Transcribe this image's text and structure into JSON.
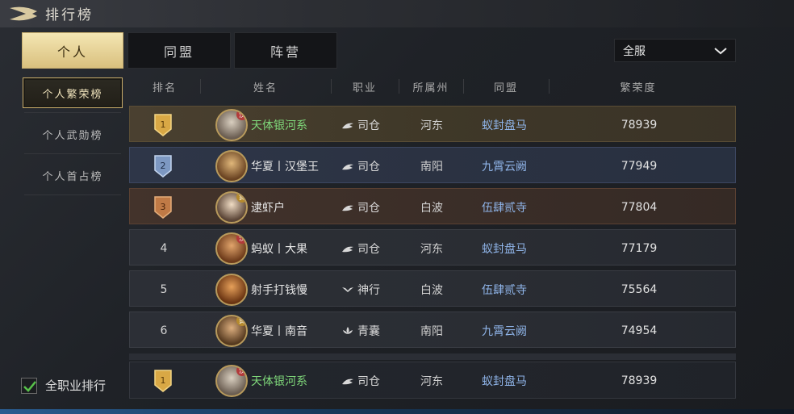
{
  "header": {
    "title": "排行榜"
  },
  "tabs": [
    {
      "label": "个人",
      "active": true
    },
    {
      "label": "同盟",
      "active": false
    },
    {
      "label": "阵营",
      "active": false
    }
  ],
  "server_select": {
    "value": "全服"
  },
  "sidebar": {
    "items": [
      {
        "label": "个人繁荣榜",
        "active": true
      },
      {
        "label": "个人武勋榜",
        "active": false
      },
      {
        "label": "个人首占榜",
        "active": false
      }
    ]
  },
  "columns": {
    "rank": "排名",
    "name": "姓名",
    "job": "职业",
    "region": "所属州",
    "alliance": "同盟",
    "score": "繁荣度"
  },
  "rows": [
    {
      "rank": "1",
      "name": "天体银河系",
      "job": "司仓",
      "region": "河东",
      "alliance": "蚁封盘马",
      "score": "78939",
      "tier": "gold",
      "name_color": "green",
      "avatar_tag": "汉"
    },
    {
      "rank": "2",
      "name": "华夏丨汉堡王",
      "job": "司仓",
      "region": "南阳",
      "alliance": "九霄云阙",
      "score": "77949",
      "tier": "silver",
      "name_color": "white",
      "avatar_tag": ""
    },
    {
      "rank": "3",
      "name": "逮虾户",
      "job": "司仓",
      "region": "白波",
      "alliance": "伍肆贰寺",
      "score": "77804",
      "tier": "bronze",
      "name_color": "white",
      "avatar_tag": "黄"
    },
    {
      "rank": "4",
      "name": "蚂蚁丨大果",
      "job": "司仓",
      "region": "河东",
      "alliance": "蚁封盘马",
      "score": "77179",
      "tier": "normal",
      "name_color": "white",
      "avatar_tag": "汉"
    },
    {
      "rank": "5",
      "name": "射手打钱慢",
      "job": "神行",
      "region": "白波",
      "alliance": "伍肆贰寺",
      "score": "75564",
      "tier": "normal",
      "name_color": "white",
      "avatar_tag": ""
    },
    {
      "rank": "6",
      "name": "华夏丨南音",
      "job": "青囊",
      "region": "南阳",
      "alliance": "九霄云阙",
      "score": "74954",
      "tier": "normal",
      "name_color": "white",
      "avatar_tag": "黄"
    }
  ],
  "self_row": {
    "rank": "1",
    "name": "天体银河系",
    "job": "司仓",
    "region": "河东",
    "alliance": "蚁封盘马",
    "score": "78939",
    "avatar_tag": "汉"
  },
  "footer": {
    "all_job_label": "全职业排行",
    "all_job_checked": true
  },
  "colors": {
    "gold_tab": "#e8d49a",
    "name_green": "#7fd87a",
    "alliance_blue": "#8fb4e8",
    "gold_border": "#c9ad6a"
  },
  "icons": {
    "back": "back-arrow-icon",
    "dropdown": "chevron-down-icon",
    "job_sicang": "hand-icon",
    "job_shenxing": "bird-icon",
    "job_qingnang": "lotus-icon",
    "rank_badge": "shield-badge-icon",
    "check": "check-icon"
  }
}
